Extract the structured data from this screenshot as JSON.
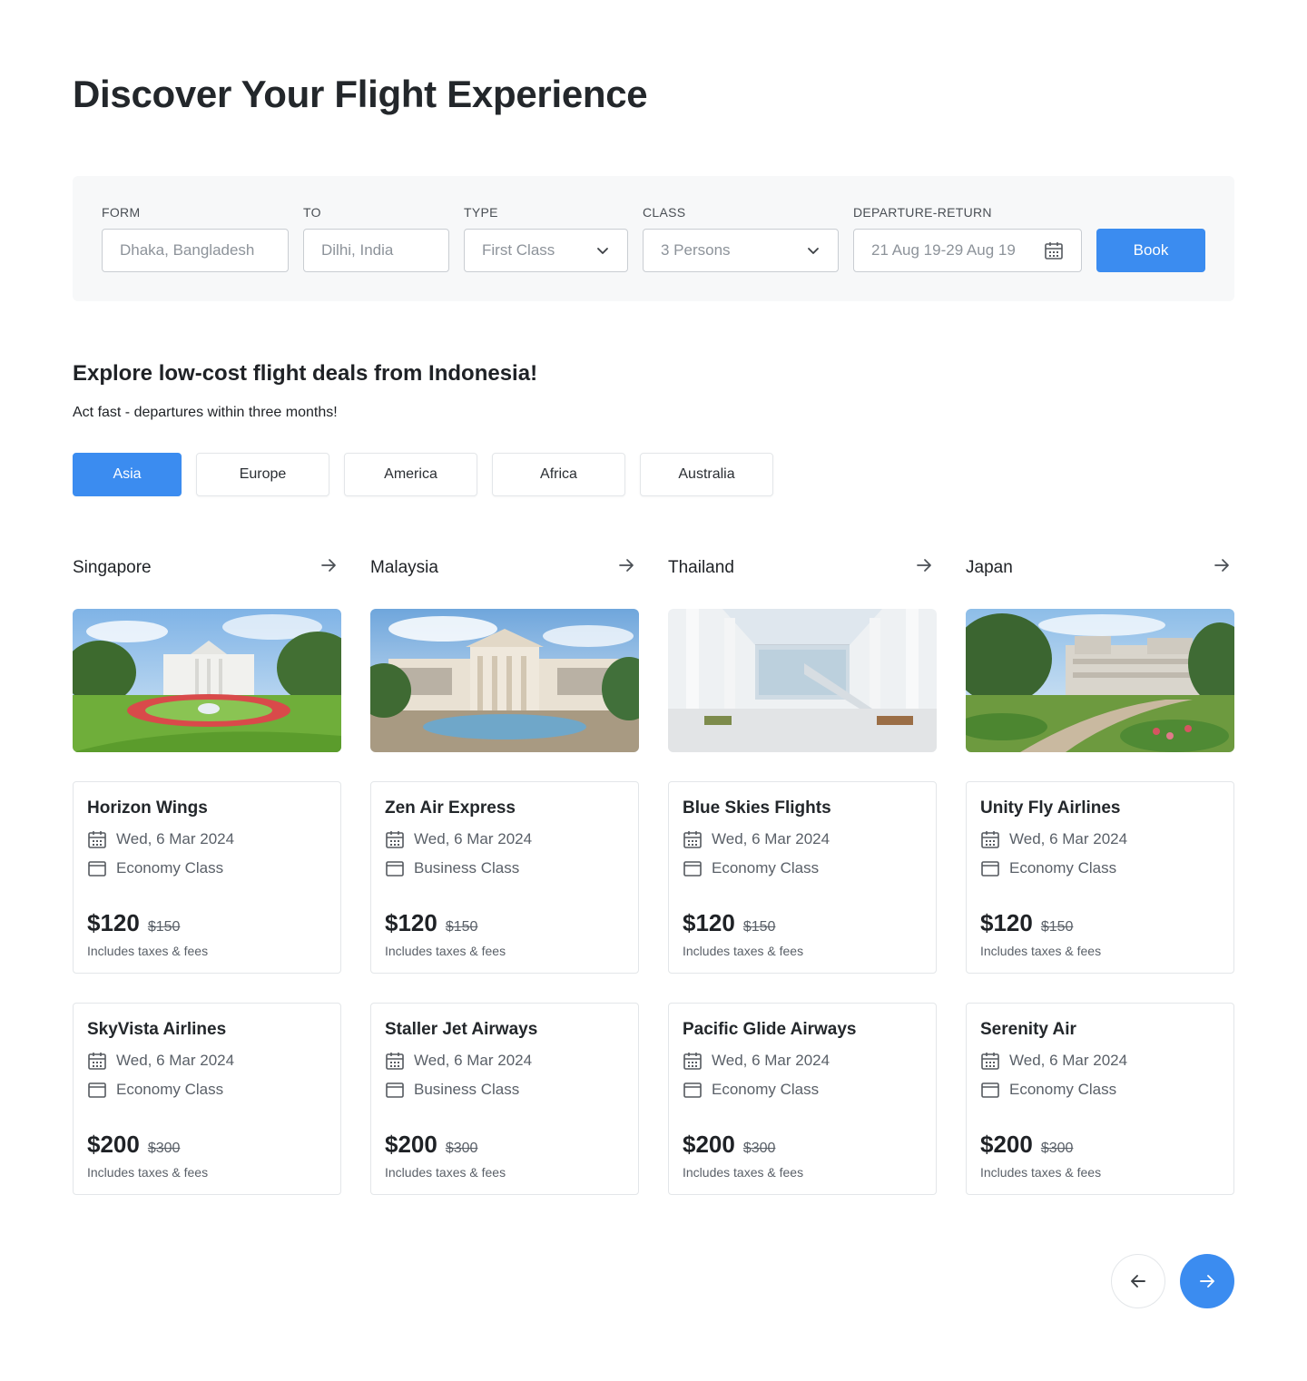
{
  "title": "Discover Your Flight Experience",
  "search": {
    "from_label": "FORM",
    "from_value": "Dhaka, Bangladesh",
    "to_label": "TO",
    "to_value": "Dilhi, India",
    "type_label": "TYPE",
    "type_value": "First Class",
    "class_label": "CLASS",
    "class_value": "3 Persons",
    "dates_label": "DEPARTURE-RETURN",
    "dates_value": "21 Aug 19-29 Aug 19",
    "book_label": "Book"
  },
  "deals": {
    "title": "Explore low-cost flight deals from Indonesia!",
    "subtitle": "Act fast - departures within three months!"
  },
  "regions": [
    "Asia",
    "Europe",
    "America",
    "Africa",
    "Australia"
  ],
  "active_region": "Asia",
  "accent_color": "#3b8cf0",
  "destinations": [
    {
      "name": "Singapore",
      "deals": [
        {
          "airline": "Horizon Wings",
          "date": "Wed, 6 Mar 2024",
          "cabin": "Economy Class",
          "price": "$120",
          "old_price": "$150",
          "note": "Includes taxes & fees"
        },
        {
          "airline": "SkyVista Airlines",
          "date": "Wed, 6 Mar 2024",
          "cabin": "Economy Class",
          "price": "$200",
          "old_price": "$300",
          "note": "Includes taxes & fees"
        }
      ]
    },
    {
      "name": "Malaysia",
      "deals": [
        {
          "airline": "Zen Air Express",
          "date": "Wed, 6 Mar 2024",
          "cabin": "Business Class",
          "price": "$120",
          "old_price": "$150",
          "note": "Includes taxes & fees"
        },
        {
          "airline": "Staller Jet Airways",
          "date": "Wed, 6 Mar 2024",
          "cabin": "Business Class",
          "price": "$200",
          "old_price": "$300",
          "note": "Includes taxes & fees"
        }
      ]
    },
    {
      "name": "Thailand",
      "deals": [
        {
          "airline": "Blue Skies Flights",
          "date": "Wed, 6 Mar 2024",
          "cabin": "Economy Class",
          "price": "$120",
          "old_price": "$150",
          "note": "Includes taxes & fees"
        },
        {
          "airline": "Pacific Glide Airways",
          "date": "Wed, 6 Mar 2024",
          "cabin": "Economy Class",
          "price": "$200",
          "old_price": "$300",
          "note": "Includes taxes & fees"
        }
      ]
    },
    {
      "name": "Japan",
      "deals": [
        {
          "airline": "Unity Fly Airlines",
          "date": "Wed, 6 Mar 2024",
          "cabin": "Economy Class",
          "price": "$120",
          "old_price": "$150",
          "note": "Includes taxes & fees"
        },
        {
          "airline": "Serenity Air",
          "date": "Wed, 6 Mar 2024",
          "cabin": "Economy Class",
          "price": "$200",
          "old_price": "$300",
          "note": "Includes taxes & fees"
        }
      ]
    }
  ]
}
